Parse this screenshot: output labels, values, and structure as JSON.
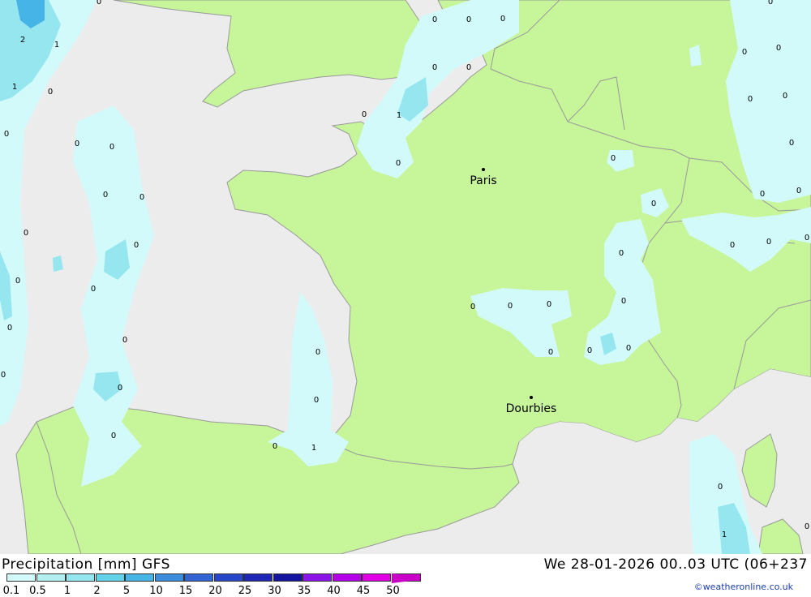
{
  "footer": {
    "title": "Precipitation [mm] GFS",
    "datetime": "We 28-01-2026 00..03 UTC (06+237",
    "credit": "©weatheronline.co.uk"
  },
  "legend": {
    "labels": [
      "0.1",
      "0.5",
      "1",
      "2",
      "5",
      "10",
      "15",
      "20",
      "25",
      "30",
      "35",
      "40",
      "45",
      "50"
    ],
    "colors": [
      "#d2fafa",
      "#b4f0f0",
      "#96e6f0",
      "#64d2e6",
      "#46b4e6",
      "#3c8cdc",
      "#3264d2",
      "#2846c8",
      "#1e28b4",
      "#1414a0",
      "#8c14e6",
      "#b400e6",
      "#e100e6",
      "#c800c8"
    ]
  },
  "map": {
    "colors": {
      "sea": "#ececec",
      "land": "#c7f59a",
      "precip_light": "#d2fafa",
      "precip_med": "#96e6f0",
      "border": "#999999"
    },
    "cities": [
      {
        "name": "Paris"
      },
      {
        "name": "Dourbies"
      }
    ],
    "values": [
      "2",
      "1",
      "1",
      "0",
      "0",
      "0",
      "0",
      "0",
      "0",
      "0",
      "0",
      "0",
      "0",
      "0",
      "0",
      "0",
      "0",
      "0",
      "0",
      "0",
      "0",
      "0",
      "1",
      "0",
      "0",
      "0",
      "0",
      "0",
      "0",
      "0",
      "0",
      "0",
      "0",
      "0",
      "0",
      "0",
      "0",
      "0",
      "0",
      "0",
      "0",
      "0",
      "0",
      "0",
      "0",
      "0",
      "0",
      "0",
      "0",
      "0",
      "0",
      "1",
      "0",
      "0",
      "0",
      "0",
      "0",
      "0",
      "0",
      "0",
      "0",
      "0",
      "0",
      "1",
      "0"
    ]
  }
}
